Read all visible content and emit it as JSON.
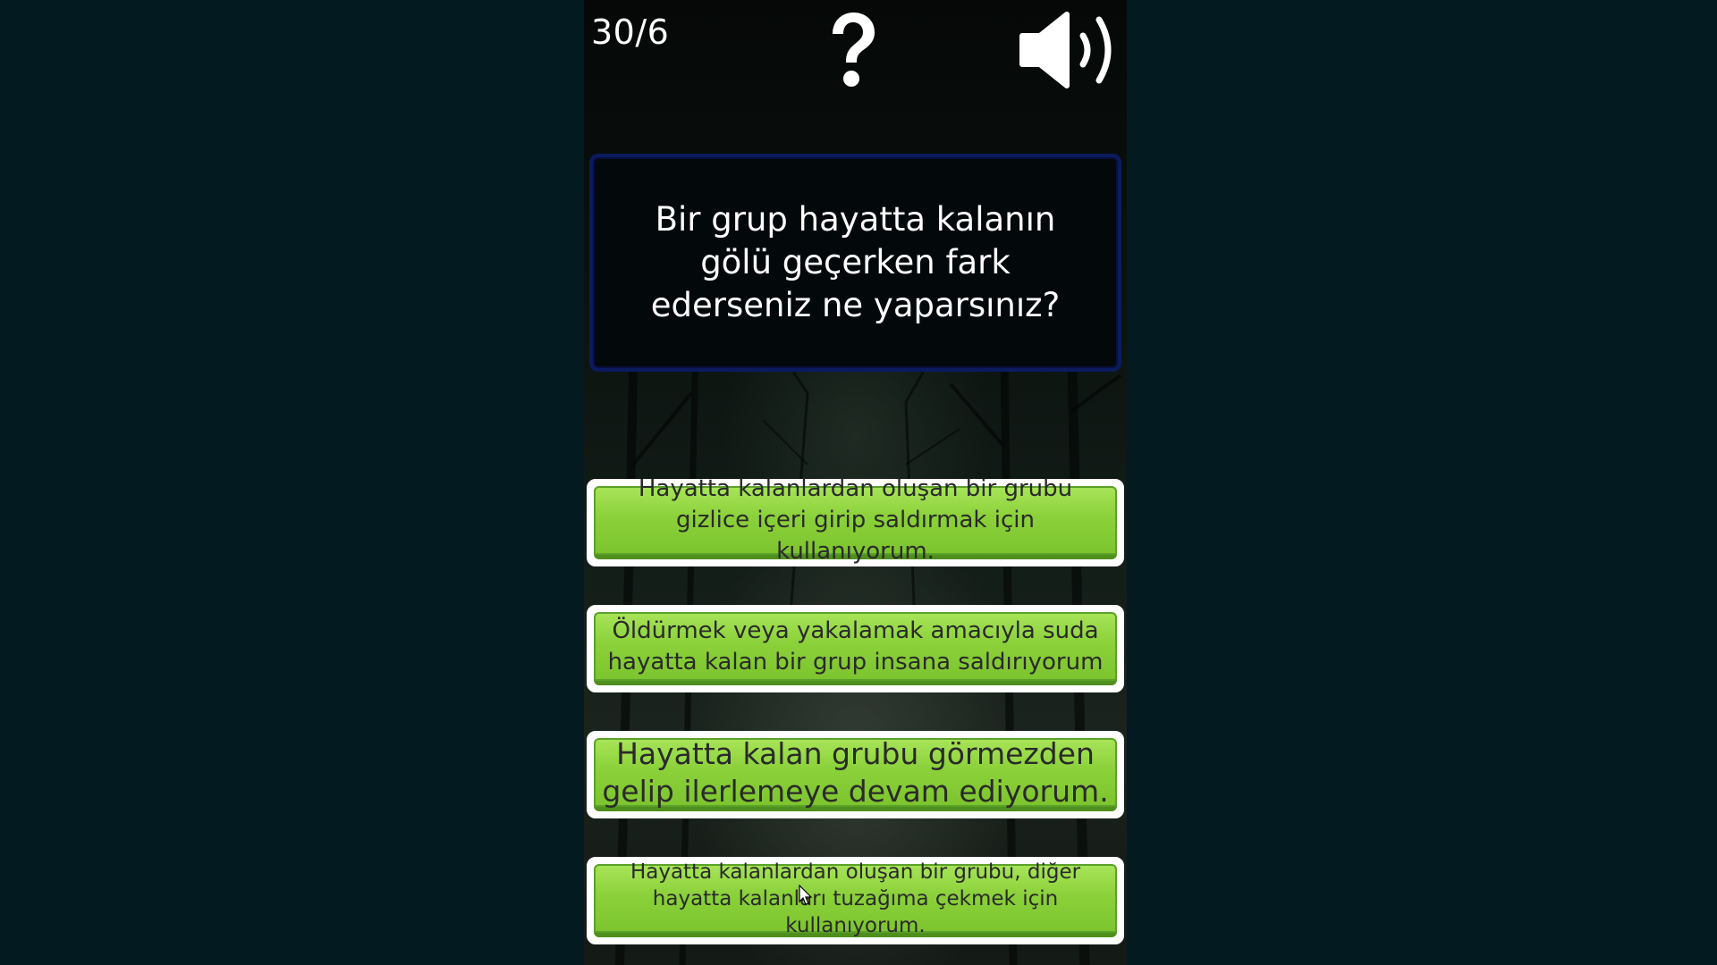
{
  "header": {
    "counter": "30/6",
    "help_icon": "question-mark-icon",
    "sound_icon": "speaker-volume-icon"
  },
  "question": {
    "text": "Bir grup hayatta kalanın gölü geçerken fark ederseniz ne yaparsınız?"
  },
  "answers": [
    {
      "text": "Hayatta kalanlardan oluşan bir grubu gizlice içeri girip saldırmak için kullanıyorum."
    },
    {
      "text": "Öldürmek veya yakalamak amacıyla suda hayatta kalan bir grup insana saldırıyorum"
    },
    {
      "text": "Hayatta kalan grubu görmezden gelip ilerlemeye devam ediyorum."
    },
    {
      "text": "Hayatta kalanlardan oluşan bir grubu, diğer hayatta kalanları tuzağıma çekmek için kullanıyorum."
    }
  ],
  "colors": {
    "answer_green": "#8bd13a",
    "question_border": "#0b1b5e",
    "outer_background": "#031a20"
  }
}
